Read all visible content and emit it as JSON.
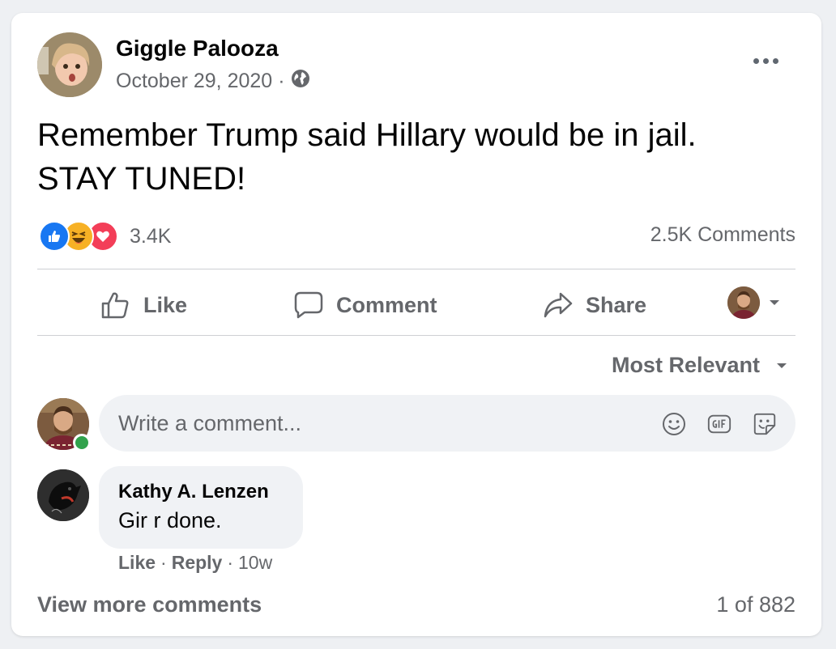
{
  "post": {
    "author": "Giggle Palooza",
    "date": "October 29, 2020",
    "separator": "·",
    "privacy_icon": "globe-icon",
    "text_line1": "Remember Trump said Hillary would be in jail.",
    "text_line2": "STAY TUNED!"
  },
  "reactions": {
    "icons": [
      "like-reaction-icon",
      "haha-reaction-icon",
      "love-reaction-icon"
    ],
    "count": "3.4K",
    "comments": "2.5K Comments"
  },
  "actions": {
    "like": "Like",
    "comment": "Comment",
    "share": "Share"
  },
  "sort": {
    "label": "Most Relevant"
  },
  "composer": {
    "placeholder": "Write a comment..."
  },
  "comment": {
    "author": "Kathy A. Lenzen",
    "text": "Gir r done.",
    "like": "Like",
    "reply": "Reply",
    "time": "10w",
    "separator": "·"
  },
  "footer": {
    "view_more": "View more comments",
    "pager": "1 of 882"
  },
  "colors": {
    "accent": "#1877f2",
    "muted_text": "#65676b",
    "online": "#31a24c",
    "love": "#f33e58",
    "haha": "#f7b125"
  }
}
